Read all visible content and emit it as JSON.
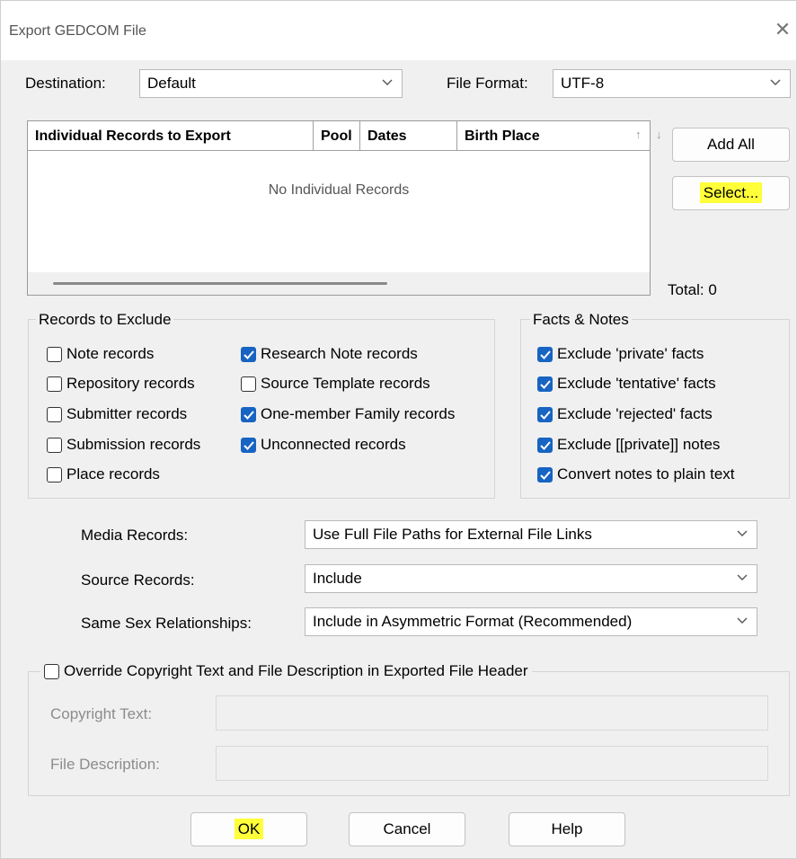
{
  "window": {
    "title": "Export GEDCOM File"
  },
  "destination": {
    "label": "Destination:",
    "value": "Default"
  },
  "file_format": {
    "label": "File Format:",
    "value": "UTF-8"
  },
  "records_list": {
    "columns": [
      "Individual Records to Export",
      "Pool",
      "Dates",
      "Birth Place"
    ],
    "empty_text": "No Individual Records"
  },
  "buttons": {
    "add_all": "Add All",
    "select": "Select...",
    "ok": "OK",
    "cancel": "Cancel",
    "help": "Help"
  },
  "total": {
    "label": "Total: 0"
  },
  "exclude_group": {
    "title": "Records to Exclude",
    "items": [
      {
        "label": "Note records",
        "checked": false
      },
      {
        "label": "Repository records",
        "checked": false
      },
      {
        "label": "Submitter records",
        "checked": false
      },
      {
        "label": "Submission records",
        "checked": false
      },
      {
        "label": "Place records",
        "checked": false
      },
      {
        "label": "Research Note records",
        "checked": true
      },
      {
        "label": "Source Template records",
        "checked": false
      },
      {
        "label": "One-member Family records",
        "checked": true
      },
      {
        "label": "Unconnected records",
        "checked": true
      }
    ]
  },
  "facts_group": {
    "title": "Facts & Notes",
    "items": [
      {
        "label": "Exclude 'private' facts",
        "checked": true
      },
      {
        "label": "Exclude 'tentative' facts",
        "checked": true
      },
      {
        "label": "Exclude 'rejected' facts",
        "checked": true
      },
      {
        "label": "Exclude [[private]] notes",
        "checked": true
      },
      {
        "label": "Convert notes to plain text",
        "checked": true
      }
    ]
  },
  "media_records": {
    "label": "Media Records:",
    "value": "Use Full File Paths for External File Links"
  },
  "source_records": {
    "label": "Source Records:",
    "value": "Include"
  },
  "same_sex": {
    "label": "Same Sex Relationships:",
    "value": "Include in Asymmetric Format (Recommended)"
  },
  "override": {
    "label": "Override Copyright Text and File Description in Exported File Header",
    "checked": false,
    "copyright_label": "Copyright Text:",
    "description_label": "File Description:"
  },
  "highlight_color": "#ffff3a",
  "check_color": "#1764c2"
}
